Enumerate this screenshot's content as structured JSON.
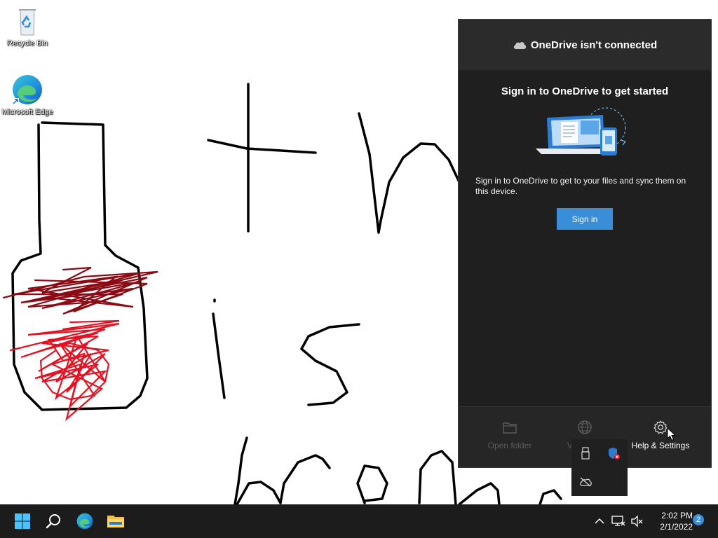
{
  "desktop": {
    "icons": [
      {
        "label": "Recycle Bin",
        "icon": "recycle-bin-icon"
      },
      {
        "label": "Microsoft Edge",
        "icon": "edge-icon"
      }
    ],
    "drawing": "freehand-ink-drawing"
  },
  "onedrive": {
    "header_title": "OneDrive isn't connected",
    "signin_title": "Sign in to OneDrive to get started",
    "signin_desc": "Sign in to OneDrive to get to your files and sync them on this device.",
    "signin_button": "Sign in",
    "footer": {
      "open_folder": "Open folder",
      "view_online": "Vi",
      "help_settings": "Help & Settings"
    }
  },
  "taskbar": {
    "time": "2:02 PM",
    "date": "2/1/2022",
    "notification_count": "2"
  },
  "colors": {
    "accent": "#3a8ed8",
    "flyout_bg": "#1f1f1f",
    "taskbar_bg": "#1c1c1c",
    "ink_dark_red": "#8b0a14",
    "ink_red": "#e81020"
  }
}
